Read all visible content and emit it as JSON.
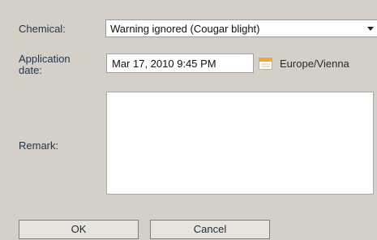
{
  "form": {
    "chemical_label": "Chemical:",
    "chemical_value": "Warning ignored (Cougar blight)",
    "application_date_label": "Application\ndate:",
    "application_date_value": "Mar 17, 2010 9:45 PM",
    "timezone": "Europe/Vienna",
    "remark_label": "Remark:",
    "remark_value": ""
  },
  "buttons": {
    "ok_label": "OK",
    "cancel_label": "Cancel"
  },
  "icons": {
    "dropdown": "chevron-down-icon",
    "calendar": "calendar-icon"
  },
  "colors": {
    "background": "#d4d0c8",
    "calendar_accent": "#f0a43a"
  }
}
